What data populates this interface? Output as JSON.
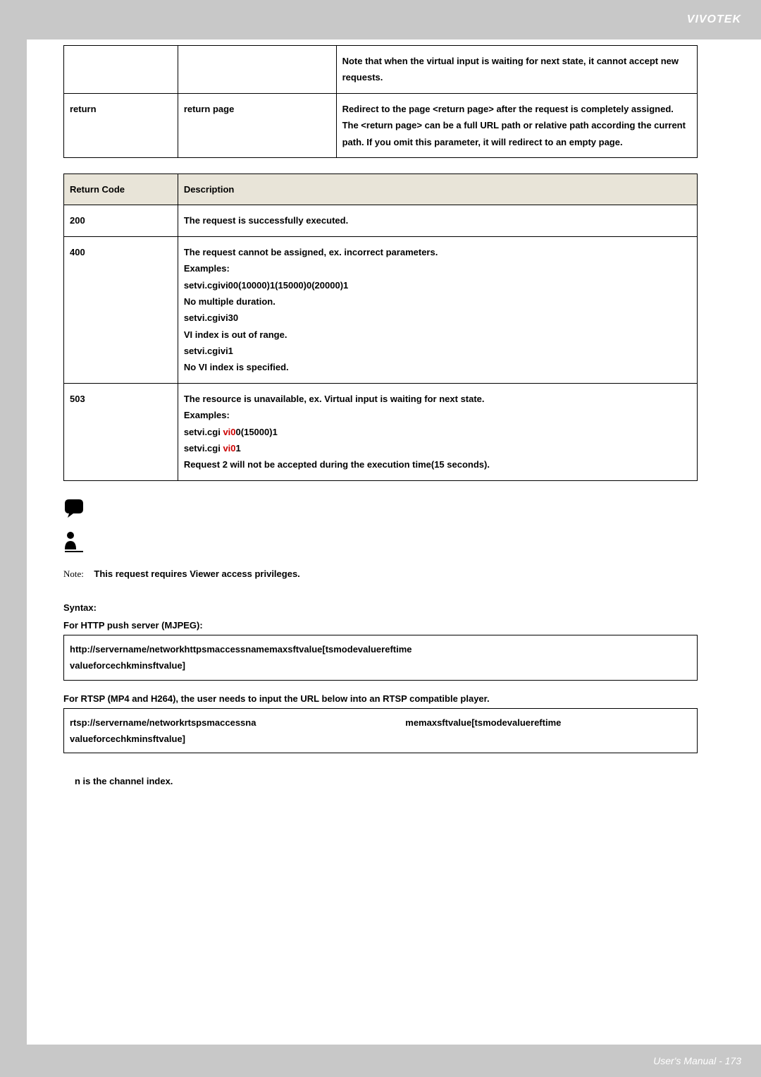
{
  "brand": "VIVOTEK",
  "table1": {
    "row0_note": "Note that when the virtual input is waiting for next state, it cannot accept new requests.",
    "row1_c0": "return",
    "row1_c1": "return page",
    "row1_c2_a": "Redirect to the page ",
    "row1_c2_b": "<return page>",
    "row1_c2_c": " after the request is completely assigned. The ",
    "row1_c2_d": "<return page>",
    "row1_c2_e": " can be a full URL path or relative path according the current path. If you omit this parameter, it will redirect to an empty page."
  },
  "table2": {
    "h0": "Return Code",
    "h1": "Description",
    "r200_c0": "200",
    "r200_c1": "The request is successfully executed.",
    "r400_c0": "400",
    "r400_l1": "The request cannot be assigned, ex. incorrect parameters.",
    "r400_l2": "Examples:",
    "r400_l3": "setvi.cgivi00(10000)1(15000)0(20000)1",
    "r400_l4": "No multiple duration.",
    "r400_l5": "setvi.cgivi30",
    "r400_l6": "VI index is out of range.",
    "r400_l7": "setvi.cgivi1",
    "r400_l8": "No VI index is specified.",
    "r503_c0": "503",
    "r503_l1": "The resource is unavailable, ex. Virtual input is waiting for next state.",
    "r503_l2": "Examples:",
    "r503_l3a": "setvi.cgi ",
    "r503_l3b": "vi0",
    "r503_l3c": "0(15000)1",
    "r503_l4a": "setvi.cgi ",
    "r503_l4b": "vi0",
    "r503_l4c": "1",
    "r503_l5": "Request 2 will not be accepted during the execution time(15 seconds)."
  },
  "note_label": "Note:",
  "note_text": "This request requires Viewer access privileges.",
  "syntax_label": "Syntax:",
  "http_label": "For HTTP push server (MJPEG):",
  "http_box_l1": "http://servername/networkhttpsmaccessnamemaxsftvalue[tsmodevaluereftime",
  "http_box_l2": "valueforcechkminsftvalue]",
  "rtsp_label": "For RTSP (MP4 and H264), the user needs to input the URL below into an RTSP compatible player.",
  "rtsp_box_l1a": "rtsp://servername/networkrtspsmaccessna",
  "rtsp_box_l1b": "memaxsftvalue[tsmodevaluereftime",
  "rtsp_box_l2": "valueforcechkminsftvalue]",
  "n_note": "n is the channel index.",
  "footer": "User's Manual - 173"
}
